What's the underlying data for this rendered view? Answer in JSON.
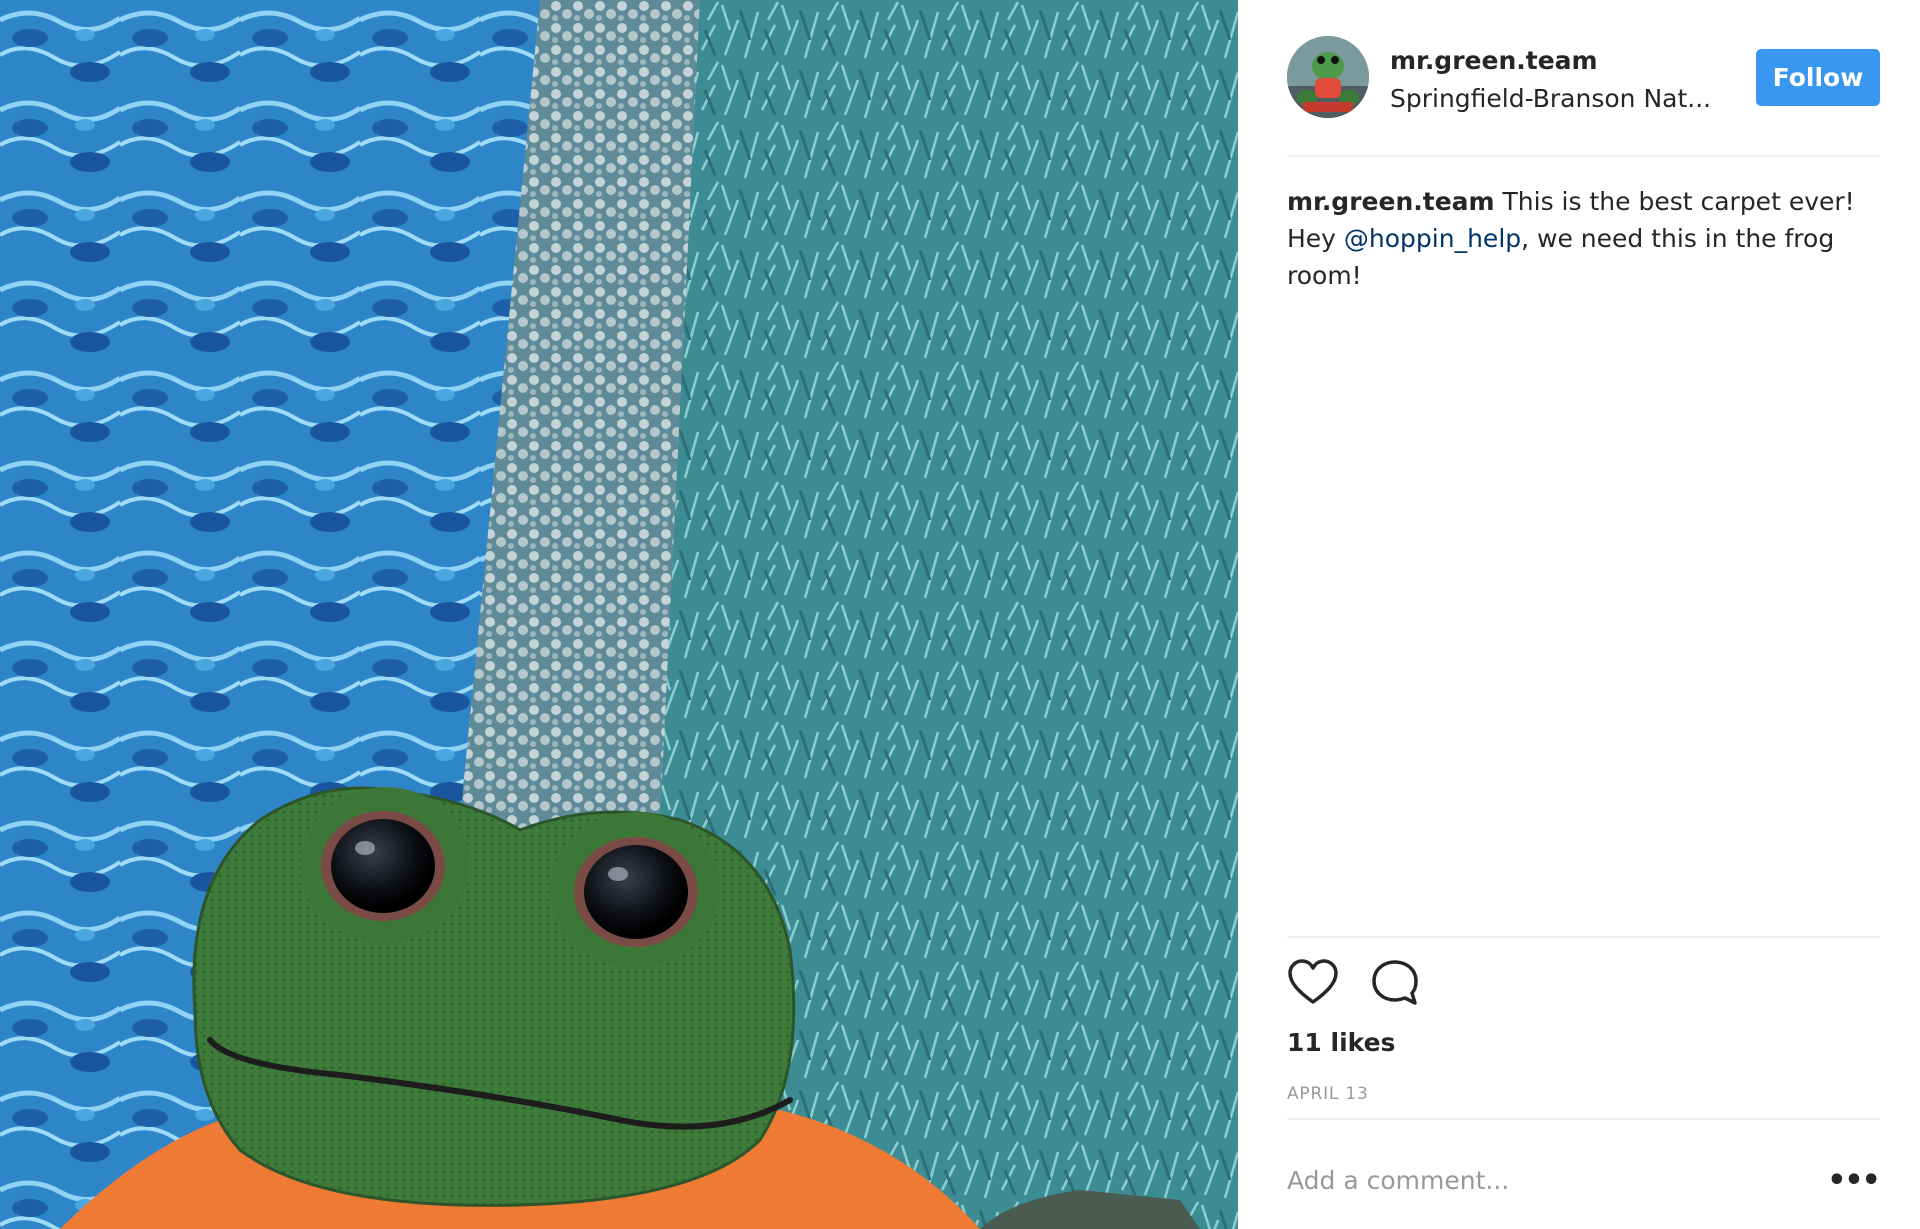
{
  "post": {
    "photo": {
      "icon": "stuffed-frog-on-carpet-photo"
    },
    "header": {
      "username": "mr.green.team",
      "location": "Springfield-Branson Nat...",
      "follow_label": "Follow"
    },
    "caption": {
      "username": "mr.green.team",
      "text_before_mention": " This is the best carpet ever! Hey ",
      "mention": "@hoppin_help",
      "text_after_mention": ", we need this in the frog room!"
    },
    "actions": {
      "like_icon": "heart-icon",
      "comment_icon": "comment-bubble-icon"
    },
    "likes": "11 likes",
    "date": "APRIL 13",
    "comment": {
      "placeholder": "Add a comment...",
      "more_icon": "ellipsis-icon",
      "more_label": "•••"
    },
    "colors": {
      "follow_button": "#3897f0",
      "mention": "#003569",
      "muted_text": "#999999",
      "primary_text": "#262626"
    }
  }
}
